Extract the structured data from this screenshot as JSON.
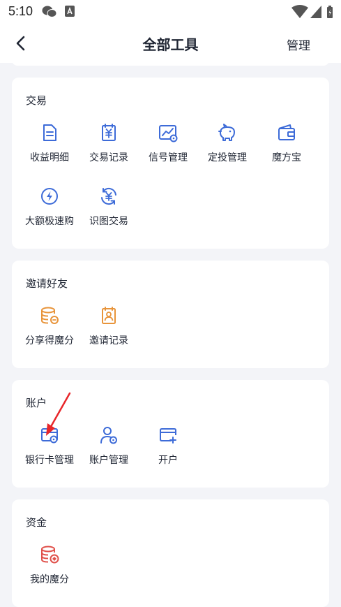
{
  "status_bar": {
    "time": "5:10"
  },
  "header": {
    "title": "全部工具",
    "manage_label": "管理"
  },
  "colors": {
    "blue": "#3d6bd8",
    "orange": "#e8943a",
    "red": "#e0504a",
    "arrow": "#e8262a"
  },
  "sections": {
    "trade": {
      "title": "交易",
      "items": [
        "收益明细",
        "交易记录",
        "信号管理",
        "定投管理",
        "魔方宝",
        "大额极速购",
        "识图交易"
      ]
    },
    "invite": {
      "title": "邀请好友",
      "items": [
        "分享得魔分",
        "邀请记录"
      ]
    },
    "account": {
      "title": "账户",
      "items": [
        "银行卡管理",
        "账户管理",
        "开户"
      ]
    },
    "funds": {
      "title": "资金",
      "items": [
        "我的魔分"
      ]
    }
  }
}
